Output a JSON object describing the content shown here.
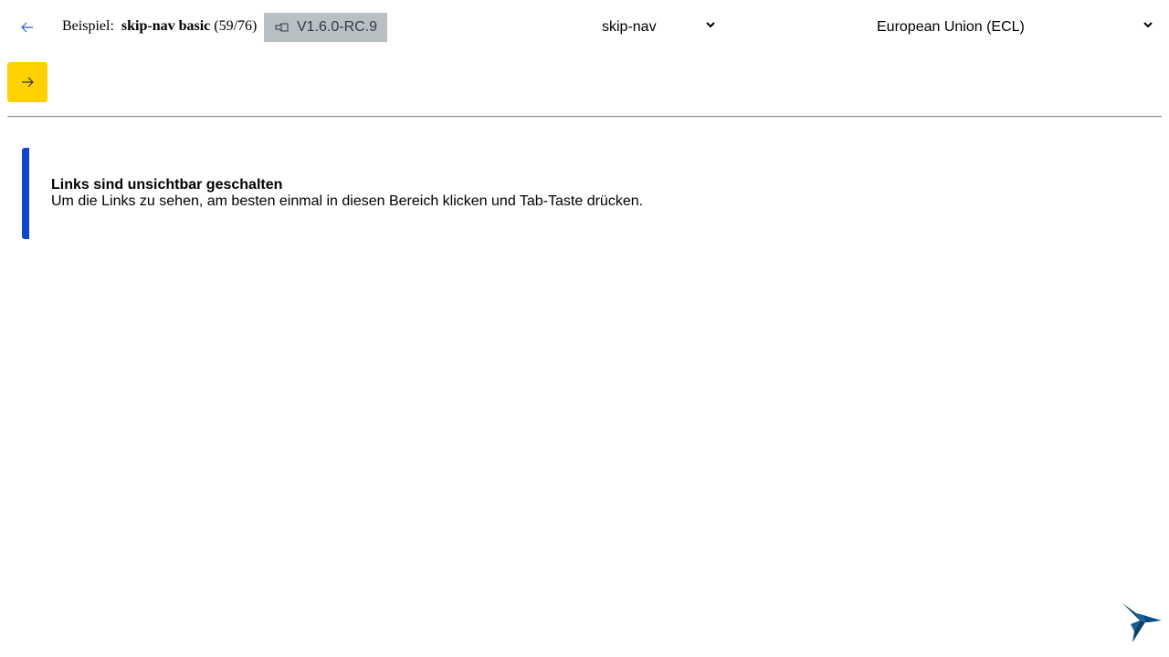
{
  "header": {
    "crumb_label": "Beispiel:",
    "example_name": "skip-nav basic",
    "example_count": "(59/76)",
    "version": "V1.6.0-RC.9"
  },
  "selects": {
    "component": "skip-nav",
    "theme": "European Union (ECL)"
  },
  "alert": {
    "title": "Links sind unsichtbar geschalten",
    "message": "Um die Links zu sehen, am besten einmal in diesen Bereich klicken und Tab-Taste drücken."
  },
  "colors": {
    "accent_blue": "#0e47cb",
    "next_button_yellow": "#ffd100",
    "badge_gray": "#b9c0c4",
    "bird_blue": "#0b4a7c"
  },
  "icons": {
    "back": "arrow-left-icon",
    "next": "arrow-right-icon",
    "version": "tag-icon",
    "select": "chevron-down-icon",
    "logo": "hummingbird-logo-icon"
  }
}
